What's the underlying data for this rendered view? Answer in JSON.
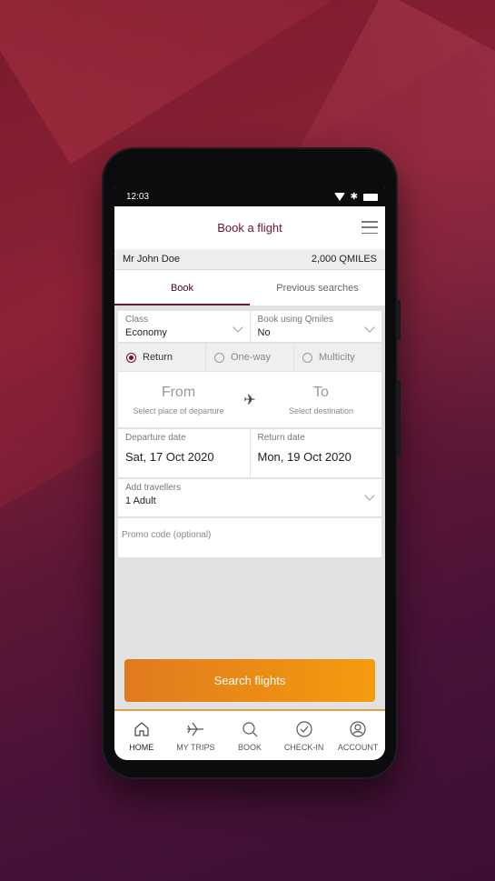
{
  "status": {
    "time": "12:03"
  },
  "header": {
    "title": "Book a flight"
  },
  "user": {
    "name": "Mr John Doe",
    "points": "2,000 QMILES"
  },
  "tabs": [
    {
      "label": "Book"
    },
    {
      "label": "Previous searches"
    }
  ],
  "form": {
    "class_label": "Class",
    "class_value": "Economy",
    "qmiles_label": "Book using Qmiles",
    "qmiles_value": "No",
    "trip_types": [
      {
        "label": "Return"
      },
      {
        "label": "One-way"
      },
      {
        "label": "Multicity"
      }
    ],
    "selected_trip_type": "Return",
    "from_label": "From",
    "from_hint": "Select place of departure",
    "to_label": "To",
    "to_hint": "Select destination",
    "departure_label": "Departure date",
    "departure_value": "Sat, 17 Oct 2020",
    "return_label": "Return date",
    "return_value": "Mon, 19 Oct 2020",
    "travellers_label": "Add travellers",
    "travellers_value": "1 Adult",
    "promo_placeholder": "Promo code (optional)",
    "search_label": "Search flights"
  },
  "nav": [
    {
      "label": "HOME",
      "icon": "home-icon"
    },
    {
      "label": "MY TRIPS",
      "icon": "plane-icon"
    },
    {
      "label": "BOOK",
      "icon": "search-icon"
    },
    {
      "label": "CHECK-IN",
      "icon": "check-circle-icon"
    },
    {
      "label": "ACCOUNT",
      "icon": "user-icon"
    }
  ],
  "colors": {
    "brand": "#6b1230",
    "accent": "#f59b0e"
  }
}
